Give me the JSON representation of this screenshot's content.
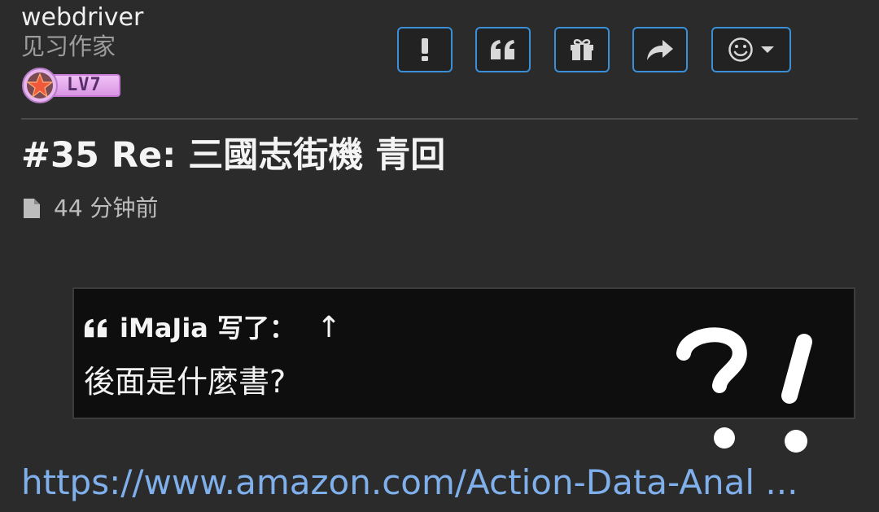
{
  "user": {
    "name": "webdriver",
    "title": "见习作家",
    "level": "LV7"
  },
  "toolbar": {
    "buttons": [
      {
        "name": "report",
        "icon": "exclamation-icon"
      },
      {
        "name": "quote",
        "icon": "quote-icon"
      },
      {
        "name": "gift",
        "icon": "gift-icon"
      },
      {
        "name": "share",
        "icon": "share-arrow-icon"
      },
      {
        "name": "reaction",
        "icon": "smiley-dropdown-icon"
      }
    ],
    "border_color": "#3a8fd6"
  },
  "post": {
    "title": "#35 Re: 三國志街機 青回",
    "time": "44 分钟前"
  },
  "quote": {
    "author_line": "iMaJia 写了：",
    "arrow": "↑",
    "text": "後面是什麼書?"
  },
  "link": {
    "text": "https://www.amazon.com/Action-Data-Anal ..."
  },
  "colors": {
    "background": "#2b2b2c",
    "link": "#7fb0ec",
    "quote_bg": "#0e0e0e"
  }
}
